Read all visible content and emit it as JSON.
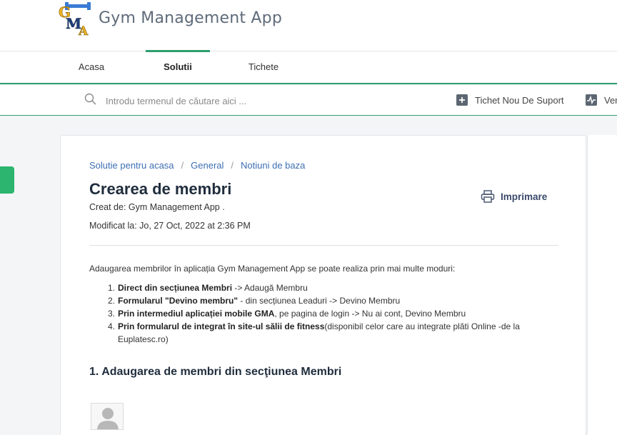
{
  "header": {
    "app_title": "Gym Management App",
    "logo_letters": "GMA"
  },
  "tabs": [
    {
      "label": "Acasa",
      "active": false
    },
    {
      "label": "Solutii",
      "active": true
    },
    {
      "label": "Tichete",
      "active": false
    }
  ],
  "search": {
    "placeholder": "Introdu termenul de căutare aici ..."
  },
  "actions": {
    "new_ticket": "Tichet Nou De Suport",
    "status_truncated": "Ver"
  },
  "breadcrumb": [
    "Solutie pentru acasa",
    "General",
    "Notiuni de baza"
  ],
  "article": {
    "title": "Crearea de membri",
    "created_by": "Creat de: Gym Management App .",
    "modified": "Modificat la: Jo, 27 Oct, 2022 at 2:36 PM",
    "print_label": "Imprimare",
    "intro": "Adaugarea membrilor în aplicația Gym Management App se poate realiza prin mai multe moduri:",
    "list": [
      {
        "num": "1.",
        "bold": "Direct din secțiunea Membri",
        "rest": " -> Adaugă Membru"
      },
      {
        "num": "2.",
        "bold": "Formularul \"Devino membru\"",
        "rest": " - din secțiunea Leaduri -> Devino Membru"
      },
      {
        "num": "3.",
        "bold": "Prin intermediul aplicației mobile GMA",
        "rest": ", pe pagina de login -> Nu ai cont, Devino Membru"
      },
      {
        "num": "4.",
        "bold": "Prin formularul de integrat în site-ul sălii de fitness",
        "rest": "(disponibil celor care au integrate plăti Online -de la Euplatesc.ro)"
      }
    ],
    "section_title": "1. Adaugarea de membri din secţiunea Membri"
  },
  "colors": {
    "accent": "#2e9e6e",
    "link": "#3d6fb3",
    "side_tab": "#2bb56e"
  }
}
